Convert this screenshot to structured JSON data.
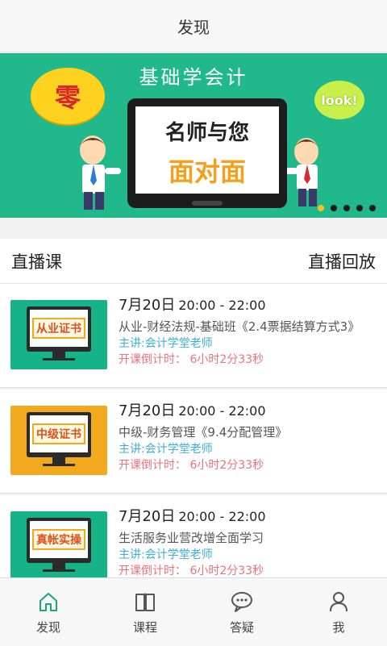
{
  "header": {
    "title": "发现"
  },
  "banner": {
    "title": "基础学会计",
    "screen_line1": "名师与您",
    "screen_line2": "面对面",
    "bubble_left": "零",
    "bubble_right": "look!",
    "active_slide": 1,
    "slide_count": 5,
    "colors": {
      "background": "#21b98b",
      "accent": "#f4a01c"
    }
  },
  "section": {
    "left_label": "直播课",
    "right_label": "直播回放"
  },
  "courses": [
    {
      "thumb_label": "从业证书",
      "thumb_color": "#17b388",
      "date": "7月20日",
      "time": "20:00 - 22:00",
      "name": "从业-财经法规-基础班《2.4票据结算方式3》",
      "teacher": "主讲:会计学堂老师",
      "countdown": "开课倒计时：  6小时2分33秒"
    },
    {
      "thumb_label": "中级证书",
      "thumb_color": "#f2a91e",
      "date": "7月20日",
      "time": "20:00 - 22:00",
      "name": "中级-财务管理《9.4分配管理》",
      "teacher": "主讲:会计学堂老师",
      "countdown": "开课倒计时：  6小时2分33秒"
    },
    {
      "thumb_label": "真帐实操",
      "thumb_color": "#17b388",
      "date": "7月20日",
      "time": "20:00 - 22:00",
      "name": "生活服务业营改增全面学习",
      "teacher": "主讲:会计学堂老师",
      "countdown": "开课倒计时：  6小时2分33秒"
    }
  ],
  "tabbar": {
    "items": [
      {
        "label": "发现",
        "icon": "home-icon",
        "active": true
      },
      {
        "label": "课程",
        "icon": "book-icon",
        "active": false
      },
      {
        "label": "答疑",
        "icon": "chat-bubble-icon",
        "active": false
      },
      {
        "label": "我",
        "icon": "person-icon",
        "active": false
      }
    ],
    "active_color": "#19a67a"
  }
}
